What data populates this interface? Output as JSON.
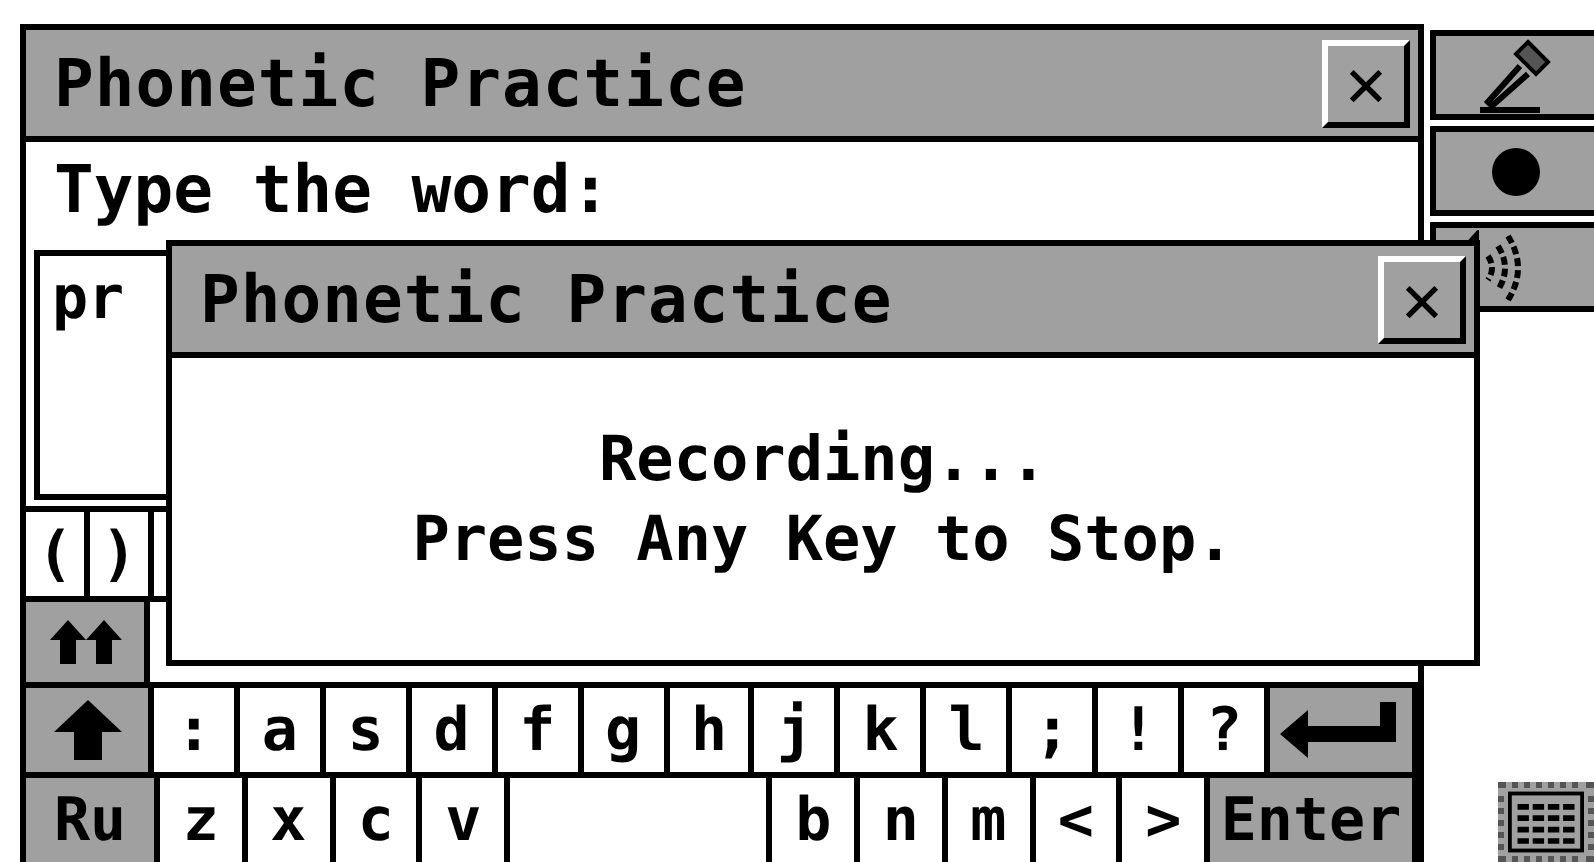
{
  "window": {
    "title": "Phonetic Practice",
    "close": "✕"
  },
  "prompt": "Type the word:",
  "answer": {
    "value": "pr"
  },
  "keyboard": [
    {
      "keys": [
        {
          "kind": "char",
          "label": "("
        },
        {
          "kind": "char",
          "label": ")"
        }
      ]
    },
    {
      "keys": [
        {
          "kind": "caps"
        }
      ]
    },
    {
      "keys": [
        {
          "kind": "shift"
        },
        {
          "kind": "char",
          "label": ":"
        },
        {
          "kind": "char",
          "label": "a"
        },
        {
          "kind": "char",
          "label": "s"
        },
        {
          "kind": "char",
          "label": "d"
        },
        {
          "kind": "char",
          "label": "f"
        },
        {
          "kind": "char",
          "label": "g"
        },
        {
          "kind": "char",
          "label": "h"
        },
        {
          "kind": "char",
          "label": "j"
        },
        {
          "kind": "char",
          "label": "k"
        },
        {
          "kind": "char",
          "label": "l"
        },
        {
          "kind": "char",
          "label": ";"
        },
        {
          "kind": "char",
          "label": "!"
        },
        {
          "kind": "char",
          "label": "?"
        },
        {
          "kind": "return"
        }
      ]
    },
    {
      "keys": [
        {
          "kind": "function",
          "label": "Ru"
        },
        {
          "kind": "char",
          "label": "z"
        },
        {
          "kind": "char",
          "label": "x"
        },
        {
          "kind": "char",
          "label": "c"
        },
        {
          "kind": "char",
          "label": "v"
        },
        {
          "kind": "space"
        },
        {
          "kind": "char",
          "label": "b"
        },
        {
          "kind": "char",
          "label": "n"
        },
        {
          "kind": "char",
          "label": "m"
        },
        {
          "kind": "char",
          "label": "<"
        },
        {
          "kind": "char",
          "label": ">"
        },
        {
          "kind": "function",
          "label": "Enter"
        }
      ]
    }
  ],
  "sidebar": [
    {
      "kind": "microphone"
    },
    {
      "kind": "record"
    },
    {
      "kind": "speaker"
    }
  ],
  "dialog": {
    "title": "Phonetic Practice",
    "close": "✕",
    "lines": [
      "Recording...",
      "Press Any Key to Stop."
    ]
  }
}
